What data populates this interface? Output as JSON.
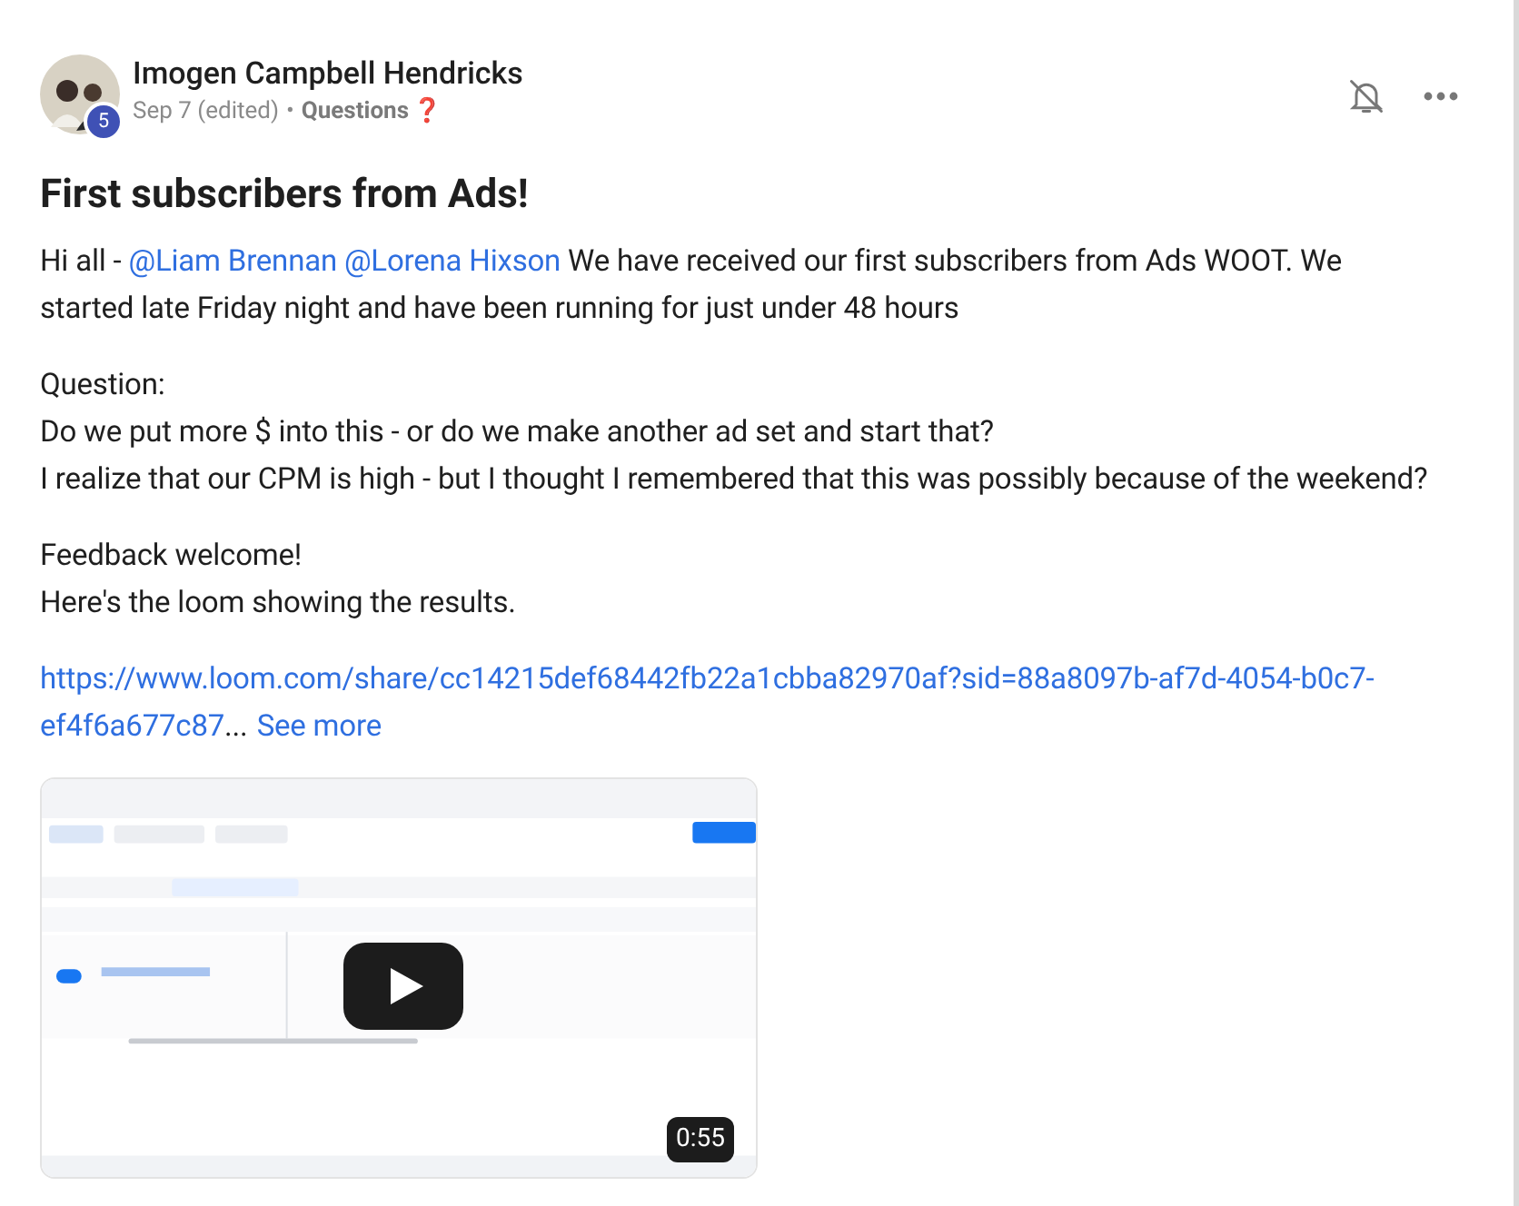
{
  "post": {
    "author": "Imogen Campbell Hendricks",
    "badge": "5",
    "date": "Sep 7 (edited)",
    "separator": "•",
    "category": "Questions",
    "category_mark": "❓",
    "title": "First subscribers from Ads!",
    "paragraphs": [
      {
        "kind": "mentions",
        "lead": "Hi all - ",
        "mentions": [
          "@Liam Brennan",
          "@Lorena Hixson"
        ],
        "text": " We have received our first subscribers from Ads WOOT. We started late Friday night and have been running for just under 48 hours"
      },
      {
        "kind": "lines",
        "lines": [
          "Question:",
          "Do we put more $ into this - or do we make another ad set and start that?",
          "I realize that our CPM is high - but I thought I remembered that this was possibly because of the weekend?"
        ]
      },
      {
        "kind": "lines",
        "lines": [
          "Feedback welcome!",
          "Here's the loom showing the results."
        ]
      },
      {
        "kind": "link",
        "url_lines": [
          "https://www.loom.com/share/cc14215def68442fb22a1cbba82970af?sid=88a8097b-af7d-4054-b0c7-",
          "ef4f6a677c87"
        ],
        "ellipsis": "...",
        "more": "See more"
      }
    ],
    "video": {
      "kind": "picture",
      "duration": "0:55"
    }
  }
}
